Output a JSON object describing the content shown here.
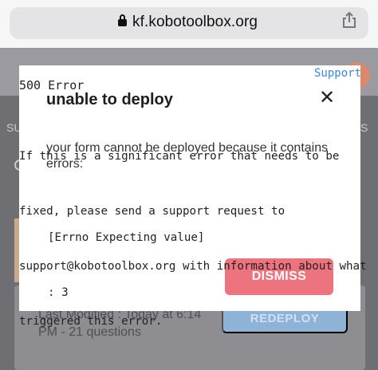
{
  "browser": {
    "url": "kf.kobotoolbox.org",
    "icons": {
      "lock": "lock-icon",
      "share": "share-icon"
    }
  },
  "background": {
    "left_fragment": "SU",
    "right_fragment": "S",
    "last_modified": "Last Modified : Today at 6:14 PM - 21 questions",
    "redeploy_label": "REDEPLOY"
  },
  "modal": {
    "title": "unable to deploy",
    "close_icon": "close-icon",
    "message": "your form cannot be deployed because it contains errors:",
    "dismiss_label": "DISMISS"
  },
  "error_page": {
    "support_link": "Support",
    "title": "500 Error",
    "body_lines": [
      "If this is a significant error that needs to be",
      "fixed, please send a support request to",
      "support@kobotoolbox.org with information about what",
      "triggered this error."
    ],
    "detail_lines": [
      "[Errno Expecting value]",
      ": 3"
    ]
  },
  "colors": {
    "dismiss": "#ed737e",
    "link": "#3d89d0",
    "redeploy": "#8fb3d7"
  }
}
